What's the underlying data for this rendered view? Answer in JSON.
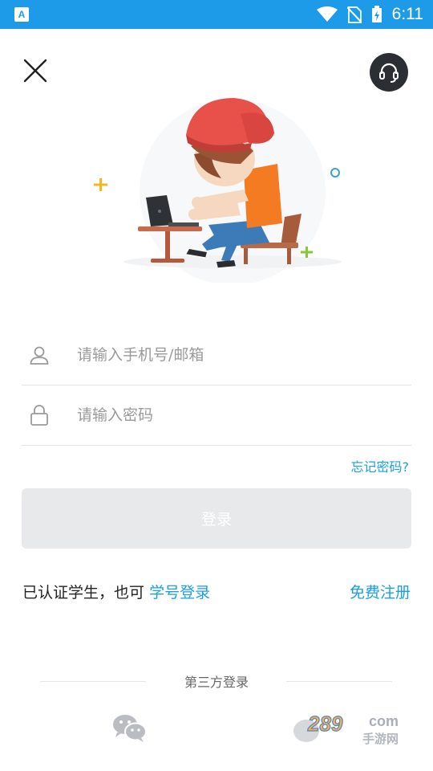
{
  "status_bar": {
    "time": "6:11",
    "app_icon_letter": "A"
  },
  "login": {
    "phone_placeholder": "请输入手机号/邮箱",
    "password_placeholder": "请输入密码",
    "forgot_password": "忘记密码?",
    "login_button": "登录",
    "student_prompt": "已认证学生，也可",
    "student_login_link": "学号登录",
    "register_link": "免费注册",
    "third_party_label": "第三方登录"
  },
  "watermark": {
    "number": "289",
    "domain": "com",
    "site_name": "手游网"
  },
  "colors": {
    "status_bar": "#1e9be8",
    "link": "#1a9fe0",
    "button_disabled": "#e8e9eb"
  }
}
